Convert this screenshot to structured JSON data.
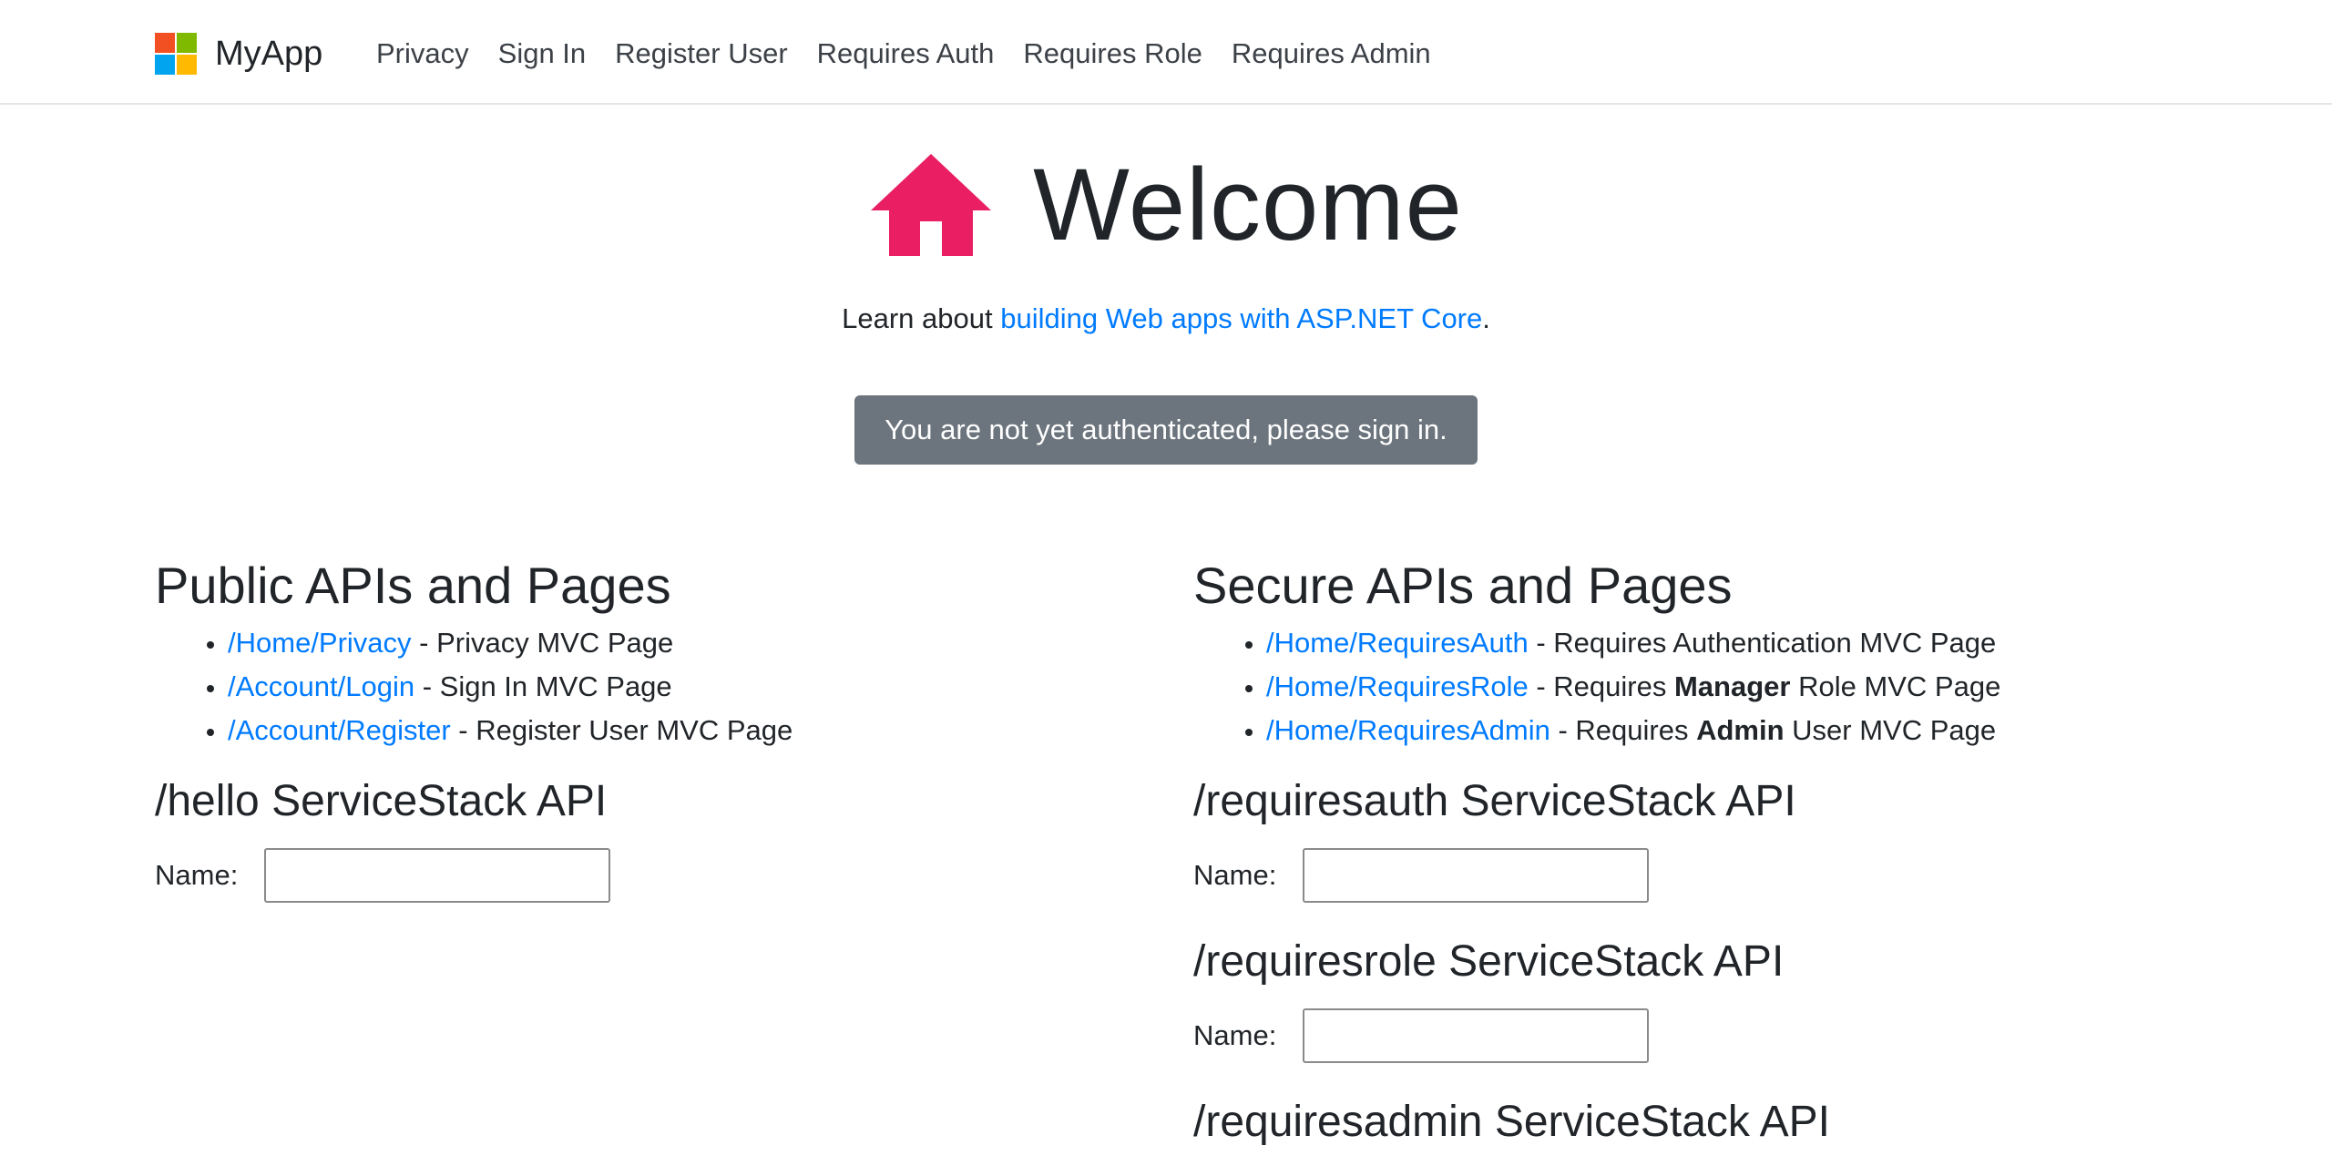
{
  "nav": {
    "brand": "MyApp",
    "logo_colors": [
      "#f25022",
      "#7fba00",
      "#00a4ef",
      "#ffb900"
    ],
    "links": [
      "Privacy",
      "Sign In",
      "Register User",
      "Requires Auth",
      "Requires Role",
      "Requires Admin"
    ]
  },
  "hero": {
    "icon": "house-icon",
    "icon_color": "#e91e63",
    "title": "Welcome"
  },
  "learn": {
    "prefix": "Learn about ",
    "link": "building Web apps with ASP.NET Core",
    "suffix": "."
  },
  "alert": "You are not yet authenticated, please sign in.",
  "public": {
    "title": "Public APIs and Pages",
    "items": [
      {
        "path": "/Home/Privacy",
        "desc": " - Privacy MVC Page"
      },
      {
        "path": "/Account/Login",
        "desc": " - Sign In MVC Page"
      },
      {
        "path": "/Account/Register",
        "desc": " - Register User MVC Page"
      }
    ],
    "api_title": "/hello ServiceStack API",
    "name_label": "Name:"
  },
  "secure": {
    "title": "Secure APIs and Pages",
    "items": [
      {
        "path": "/Home/RequiresAuth",
        "desc_pre": " - Requires Authentication MVC Page",
        "bold": "",
        "desc_post": ""
      },
      {
        "path": "/Home/RequiresRole",
        "desc_pre": " - Requires ",
        "bold": "Manager",
        "desc_post": " Role MVC Page"
      },
      {
        "path": "/Home/RequiresAdmin",
        "desc_pre": " - Requires ",
        "bold": "Admin",
        "desc_post": " User MVC Page"
      }
    ],
    "apis": [
      {
        "title": "/requiresauth ServiceStack API",
        "label": "Name:"
      },
      {
        "title": "/requiresrole ServiceStack API",
        "label": "Name:"
      },
      {
        "title": "/requiresadmin ServiceStack API"
      }
    ]
  },
  "colors": {
    "link": "#007bff",
    "alert_bg": "#6c757d"
  }
}
